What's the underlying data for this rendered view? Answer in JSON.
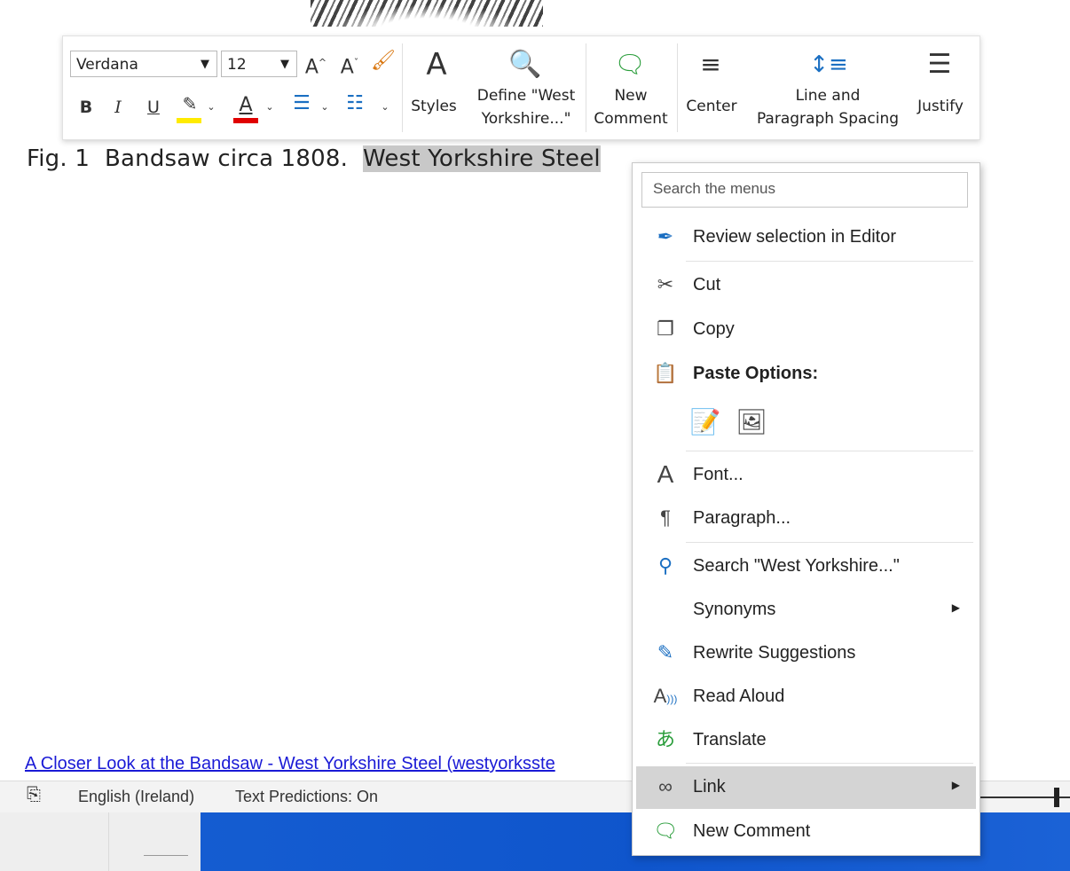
{
  "toolbar": {
    "font_name": "Verdana",
    "font_size": "12",
    "grow_font_label": "A",
    "shrink_font_label": "A",
    "bold_label": "B",
    "italic_label": "I",
    "underline_label": "U",
    "font_color_label": "A",
    "highlight_color": "#ffeb00",
    "font_color": "#e00000",
    "styles_label": "Styles",
    "define_label_line1": "Define \"West",
    "define_label_line2": "Yorkshire...\"",
    "new_comment_line1": "New",
    "new_comment_line2": "Comment",
    "center_label": "Center",
    "spacing_line1": "Line and",
    "spacing_line2": "Paragraph Spacing",
    "justify_label": "Justify"
  },
  "document": {
    "caption_prefix": "Fig. 1  Bandsaw circa 1808.  ",
    "caption_selected": "West Yorkshire Steel",
    "link_text": "A Closer Look at the Bandsaw - West Yorkshire Steel (westyorksste"
  },
  "status_bar": {
    "language": "English (Ireland)",
    "text_predictions": "Text Predictions: On"
  },
  "context_menu": {
    "search_placeholder": "Search the menus",
    "review": "Review selection in Editor",
    "cut": "Cut",
    "copy": "Copy",
    "paste_options": "Paste Options:",
    "font": "Font...",
    "paragraph": "Paragraph...",
    "search": "Search \"West Yorkshire...\"",
    "synonyms": "Synonyms",
    "rewrite": "Rewrite Suggestions",
    "read_aloud": "Read Aloud",
    "translate": "Translate",
    "link": "Link",
    "new_comment": "New Comment"
  }
}
